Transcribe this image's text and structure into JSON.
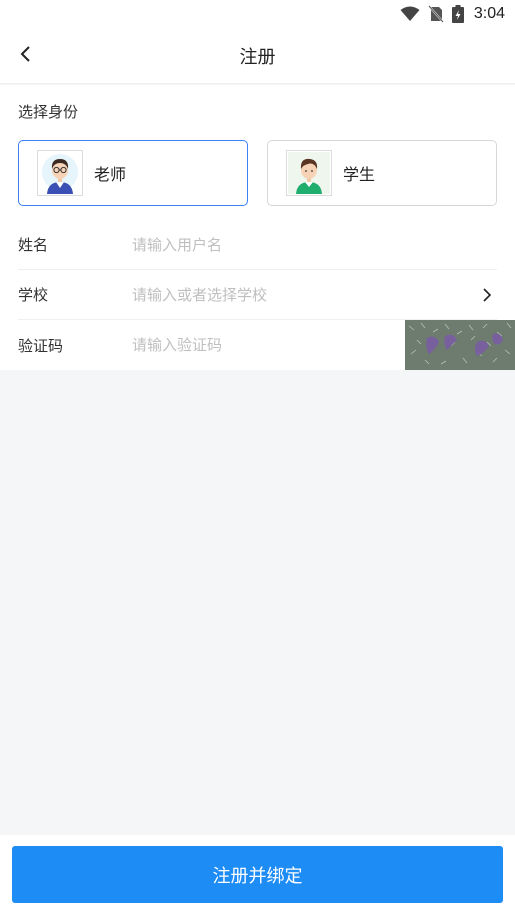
{
  "status_bar": {
    "time": "3:04",
    "icons": [
      "wifi-icon",
      "no-sim-icon",
      "battery-charging-icon"
    ]
  },
  "header": {
    "title": "注册",
    "back_icon": "chevron-left-icon"
  },
  "identity": {
    "section_label": "选择身份",
    "selected": "teacher",
    "options": [
      {
        "key": "teacher",
        "label": "老师",
        "icon": "teacher-avatar-icon"
      },
      {
        "key": "student",
        "label": "学生",
        "icon": "student-avatar-icon"
      }
    ]
  },
  "form": {
    "name": {
      "label": "姓名",
      "placeholder": "请输入用户名",
      "value": ""
    },
    "school": {
      "label": "学校",
      "placeholder": "请输入或者选择学校",
      "value": "",
      "icon": "chevron-right-icon"
    },
    "captcha": {
      "label": "验证码",
      "placeholder": "请输入验证码",
      "value": "",
      "image": "captcha-image"
    }
  },
  "submit_label": "注册并绑定",
  "colors": {
    "accent": "#1e8cf5",
    "selected_border": "#3b82f6",
    "page_background": "#f5f6f8",
    "placeholder": "#bfbfbf"
  }
}
